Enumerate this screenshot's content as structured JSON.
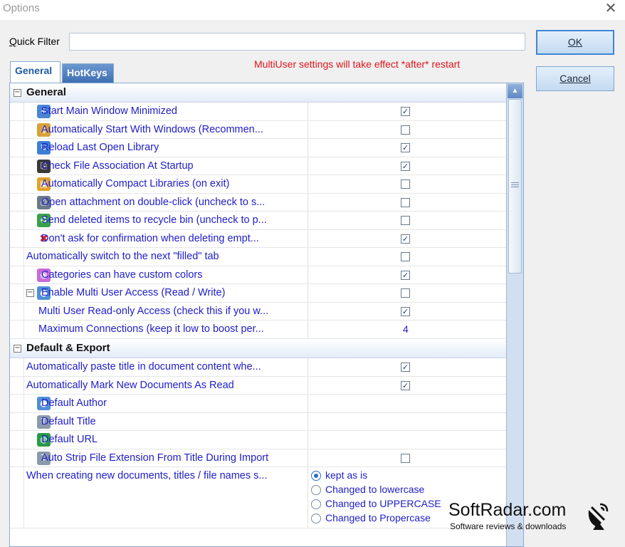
{
  "window": {
    "title": "Options"
  },
  "quick_filter": {
    "label_first": "Q",
    "label_rest": "uick Filter",
    "value": ""
  },
  "buttons": {
    "ok": "OK",
    "cancel": "Cancel"
  },
  "tabs": [
    {
      "label": "General",
      "active": true
    },
    {
      "label": "HotKeys",
      "active": false
    }
  ],
  "notice": "MultiUser settings will take effect *after* restart",
  "groups": {
    "general": {
      "title": "General"
    },
    "default_export": {
      "title": "Default & Export"
    }
  },
  "items": [
    {
      "label": "Start Main Window Minimized",
      "icon": "window-plus-icon",
      "checked": true
    },
    {
      "label": "Automatically Start With Windows (Recommen...",
      "icon": "key-icon",
      "checked": false
    },
    {
      "label": "Reload Last Open Library",
      "icon": "reload-icon",
      "checked": true
    },
    {
      "label": "Check File Association At Startup",
      "icon": "file-association-icon",
      "checked": true
    },
    {
      "label": "Automatically Compact Libraries (on exit)",
      "icon": "compact-icon",
      "checked": false
    },
    {
      "label": "Open attachment on double-click (uncheck to s...",
      "icon": "attachment-icon",
      "checked": false
    },
    {
      "label": "Send deleted items to recycle bin (uncheck to p...",
      "icon": "recycle-bin-icon",
      "checked": false
    },
    {
      "label": "Don't ask for confirmation when deleting empt...",
      "icon": "red-x-icon",
      "checked": true
    },
    {
      "label": "Automatically switch to the next \"filled\" tab",
      "icon": "",
      "checked": false
    },
    {
      "label": "Categories can have custom colors",
      "icon": "color-wheel-icon",
      "checked": true
    },
    {
      "label": "Enable Multi User Access (Read / Write)",
      "icon": "user-icon",
      "checked": false
    },
    {
      "label": "Multi User Read-only Access (check this if you w...",
      "icon": "",
      "checked": true
    },
    {
      "label": "Maximum Connections (keep it low to boost per...",
      "icon": "",
      "value": "4"
    },
    {
      "label": "Automatically paste title in document content whe...",
      "icon": "",
      "checked": true
    },
    {
      "label": "Automatically Mark New Documents As Read",
      "icon": "",
      "checked": true
    },
    {
      "label": "Default Author",
      "icon": "user-icon",
      "value": ""
    },
    {
      "label": "Default Title",
      "icon": "title-icon",
      "value": ""
    },
    {
      "label": "Default URL",
      "icon": "globe-icon",
      "value": ""
    },
    {
      "label": "Auto Strip File Extension From Title During Import",
      "icon": "title-icon",
      "checked": false
    },
    {
      "label": "When creating new documents, titles / file names s...",
      "icon": ""
    }
  ],
  "radio_options": [
    {
      "label": "kept as is",
      "selected": true
    },
    {
      "label": "Changed to lowercase",
      "selected": false
    },
    {
      "label": "Changed to UPPERCASE",
      "selected": false
    },
    {
      "label": "Changed to Propercase",
      "selected": false
    }
  ],
  "watermark": {
    "title": "SoftRadar.com",
    "subtitle": "Software reviews & downloads"
  },
  "colors": {
    "link_text": "#2020c8",
    "notice": "#e0141c",
    "accent": "#3f85d4"
  }
}
